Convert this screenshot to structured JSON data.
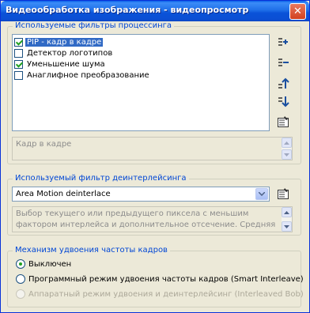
{
  "window": {
    "title": "Видеообработка изображения - видеопросмотр",
    "close_label": "✕"
  },
  "filters": {
    "group_label": "Используемые фильтры процессинга",
    "items": [
      {
        "label": "PIP - кадр в кадре",
        "checked": true,
        "selected": true
      },
      {
        "label": "Детектор логотипов",
        "checked": false,
        "selected": false
      },
      {
        "label": "Уменьшение шума",
        "checked": true,
        "selected": false
      },
      {
        "label": "Анаглифное преобразование",
        "checked": false,
        "selected": false
      }
    ],
    "description": "Кадр в кадре",
    "buttons": [
      "add-filter-icon",
      "remove-filter-icon",
      "move-up-icon",
      "move-down-icon",
      "properties-icon"
    ]
  },
  "deinterlace": {
    "group_label": "Используемый фильтр деинтерлейсинга",
    "selected": "Area Motion deinterlace",
    "description": "Выбор текущего или предыдущего пиксела с меньшим фактором интерлейса и дополнительное отсечение. Средняя"
  },
  "framerate": {
    "group_label": "Механизм удвоения частоты кадров",
    "options": [
      {
        "label": "Выключен",
        "selected": true,
        "disabled": false
      },
      {
        "label": "Программный режим удвоения частоты кадров (Smart Interleave)",
        "selected": false,
        "disabled": false
      },
      {
        "label": "Аппаратный режим удвоения и деинтерлейсинг (Interleaved Bob)",
        "selected": false,
        "disabled": true
      }
    ]
  },
  "colors": {
    "group_label": "#0046d5",
    "titlebar": "#0a52d8",
    "selection": "#316ac5"
  }
}
